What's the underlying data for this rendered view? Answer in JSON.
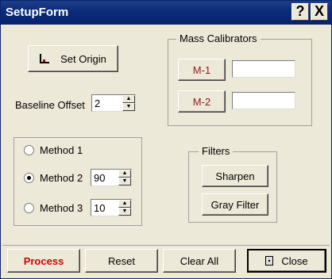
{
  "window": {
    "title": "SetupForm",
    "help_label": "?",
    "close_label": "X"
  },
  "origin": {
    "set_origin_label": "Set Origin"
  },
  "baseline": {
    "label": "Baseline Offset",
    "value": "2"
  },
  "mass_calibrators": {
    "group_label": "Mass Calibrators",
    "m1_label": "M-1",
    "m1_value": "",
    "m2_label": "M-2",
    "m2_value": ""
  },
  "methods": {
    "method1_label": "Method 1",
    "method2_label": "Method 2",
    "method2_value": "90",
    "method3_label": "Method 3",
    "method3_value": "10",
    "selected": "Method 2"
  },
  "filters": {
    "group_label": "Filters",
    "sharpen_label": "Sharpen",
    "gray_filter_label": "Gray Filter"
  },
  "bottom": {
    "process_label": "Process",
    "reset_label": "Reset",
    "clear_all_label": "Clear All",
    "close_label": "Close"
  },
  "colors": {
    "title_bar": "#0b2a78",
    "process_text": "#d40000",
    "calibrator_text": "#8b1a1a"
  }
}
